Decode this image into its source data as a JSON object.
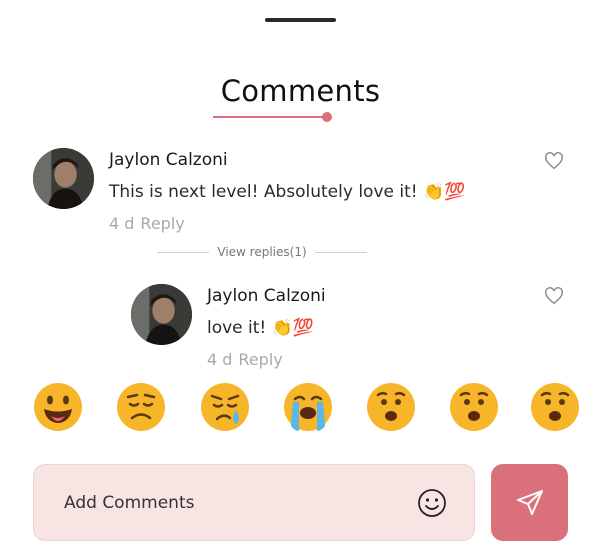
{
  "title": "Comments",
  "comments": [
    {
      "author": "Jaylon Calzoni",
      "text": "This is next level! Absolutely love it! 👏💯",
      "time": "4 d",
      "reply_label": "Reply"
    },
    {
      "author": "Jaylon Calzoni",
      "text": "love it! 👏💯",
      "time": "4 d",
      "reply_label": "Reply"
    }
  ],
  "view_replies": "View replies(1)",
  "emojis": [
    "grinning-tongue",
    "worried",
    "sad-tear",
    "loudly-crying",
    "anguished",
    "anguished",
    "anguished"
  ],
  "composer": {
    "placeholder": "Add Comments"
  },
  "colors": {
    "accent": "#d9707a",
    "input_bg": "#f9e4e4",
    "emoji_yellow": "#f7b52a"
  }
}
